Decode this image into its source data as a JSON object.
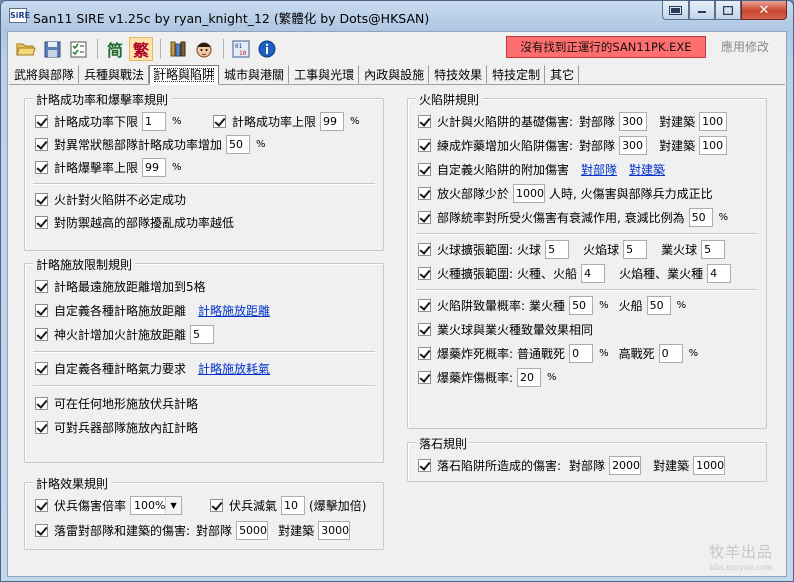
{
  "window": {
    "title": "San11 SIRE v1.25c by ryan_knight_12 (繁體化 by Dots@HKSAN)",
    "icon_text": "SiRE",
    "controls": {
      "close": "✕"
    }
  },
  "toolbar": {
    "icons": [
      "folder-open-icon",
      "save-icon",
      "checklist-icon",
      "simplified-chinese",
      "traditional-chinese",
      "database-icon",
      "character-icon",
      "binary-icon",
      "info-icon"
    ],
    "simplified_label": "简",
    "traditional_label": "繁",
    "status_text": "沒有找到正運行的SAN11PK.EXE",
    "apply_label": "應用修改",
    "status_color": "#ff6f6f"
  },
  "tabs": [
    {
      "label": "武將與部隊"
    },
    {
      "label": "兵種與戰法"
    },
    {
      "label": "計略與陷阱",
      "active": true
    },
    {
      "label": "城市與港關"
    },
    {
      "label": "工事與光環"
    },
    {
      "label": "內政與設施"
    },
    {
      "label": "特技效果"
    },
    {
      "label": "特技定制"
    },
    {
      "label": "其它"
    }
  ],
  "groups": {
    "success": {
      "title": "計略成功率和爆擊率規則",
      "min_rate_label": "計略成功率下限",
      "min_rate_value": "1",
      "max_rate_label": "計略成功率上限",
      "max_rate_value": "99",
      "abnormal_label": "對異常狀態部隊計略成功率增加",
      "abnormal_value": "50",
      "crit_label": "計略爆擊率上限",
      "crit_value": "99",
      "fire_trap_label": "火計對火陷阱不必定成功",
      "defense_label": "對防禦越高的部隊擾亂成功率越低",
      "unit": "%"
    },
    "range": {
      "title": "計略施放限制規則",
      "range_inc_label": "計略最遠施放距離增加到5格",
      "custom_range_label": "自定義各種計略施放距離",
      "custom_range_link": "計略施放距離",
      "shenhuo_label": "神火計增加火計施放距離",
      "shenhuo_value": "5",
      "custom_energy_label": "自定義各種計略氣力要求",
      "custom_energy_link": "計略施放耗氣",
      "ambush_label": "可在任何地形施放伏兵計略",
      "internal_label": "可對兵器部隊施放內訌計略"
    },
    "effect": {
      "title": "計略效果規則",
      "ambush_dmg_label": "伏兵傷害倍率",
      "ambush_dmg_value": "100%",
      "ambush_morale_label": "伏兵減氣",
      "ambush_morale_value": "10",
      "ambush_morale_note": "(爆擊加倍)",
      "thunder_label": "落雷對部隊和建築的傷害:",
      "vs_unit_label": "對部隊",
      "vs_unit_value": "5000",
      "vs_building_label": "對建築",
      "vs_building_value": "3000"
    },
    "fire": {
      "title": "火陷阱規則",
      "base_label": "火計與火陷阱的基礎傷害:",
      "base_unit_value": "300",
      "base_building_value": "100",
      "bomb_label": "練成炸藥增加火陷阱傷害:",
      "bomb_unit_value": "300",
      "bomb_building_value": "100",
      "vs_unit_label": "對部隊",
      "vs_building_label": "對建築",
      "custom_extra_label": "自定義火陷阱的附加傷害",
      "custom_extra_unit_link": "對部隊",
      "custom_extra_building_link": "對建築",
      "few_troops_label_a": "放火部隊少於",
      "few_troops_value": "1000",
      "few_troops_label_b": "人時, 火傷害與部隊兵力成正比",
      "decay_label": "部隊統率對所受火傷害有衰減作用, 衰減比例為",
      "decay_value": "50",
      "fireball_label": "火球擴張範圍:",
      "fireball_name": "火球",
      "fireball_value": "5",
      "flameball_name": "火焰球",
      "flameball_value": "5",
      "karmaball_name": "業火球",
      "karmaball_value": "5",
      "firekind_label": "火種擴張範圍:",
      "firekind_name": "火種、火船",
      "firekind_value": "4",
      "flamekind_name": "火焰種、業火種",
      "flamekind_value": "4",
      "lethal_label": "火陷阱致暈概率:",
      "karma_seed_name": "業火種",
      "karma_seed_value": "50",
      "fireship_name": "火船",
      "fireship_value": "50",
      "same_effect_label": "業火球與業火種致暈效果相同",
      "bomb_kill_label": "爆藥炸死概率:",
      "normal_death_name": "普通戰死",
      "normal_death_value": "0",
      "high_death_name": "高戰死",
      "high_death_value": "0",
      "bomb_injure_label": "爆藥炸傷概率:",
      "bomb_injure_value": "20",
      "unit": "%"
    },
    "rock": {
      "title": "落石規則",
      "label": "落石陷阱所造成的傷害:",
      "vs_unit_label": "對部隊",
      "vs_unit_value": "2000",
      "vs_building_label": "對建築",
      "vs_building_value": "1000"
    }
  },
  "watermark": {
    "line1": "牧羊出品",
    "line2": "bbs.muyou.com"
  }
}
